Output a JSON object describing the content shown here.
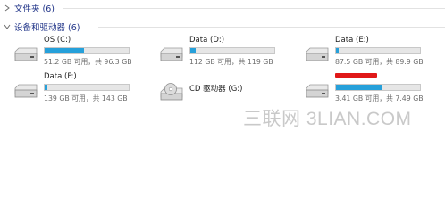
{
  "groups": {
    "folders": {
      "label": "文件夹 (6)",
      "expanded": false
    },
    "devices": {
      "label": "设备和驱动器 (6)",
      "expanded": true
    }
  },
  "drives": {
    "c": {
      "label": "OS (C:)",
      "info": "51.2 GB 可用，共 96.3 GB",
      "used_fraction": 0.47,
      "icon": "hard-drive-icon"
    },
    "d": {
      "label": "Data (D:)",
      "info": "112 GB 可用，共 119 GB",
      "used_fraction": 0.06,
      "icon": "hard-drive-icon"
    },
    "e": {
      "label": "Data (E:)",
      "info": "87.5 GB 可用，共 89.9 GB",
      "used_fraction": 0.03,
      "icon": "hard-drive-icon"
    },
    "f": {
      "label": "Data (F:)",
      "info": "139 GB 可用，共 143 GB",
      "used_fraction": 0.03,
      "icon": "hard-drive-icon"
    },
    "g": {
      "label": "CD 驱动器 (G:)",
      "icon": "cd-drive-icon"
    },
    "h": {
      "label": "",
      "info": "3.41 GB 可用，共 7.49 GB",
      "used_fraction": 0.54,
      "icon": "hard-drive-icon",
      "label_redacted": true
    }
  },
  "colors": {
    "bar_fill": "#26a0da",
    "bar_track": "#e6e6e6",
    "header_text": "#1e3287",
    "redaction": "#e01818"
  },
  "watermark": "三联网 3LIAN.COM"
}
